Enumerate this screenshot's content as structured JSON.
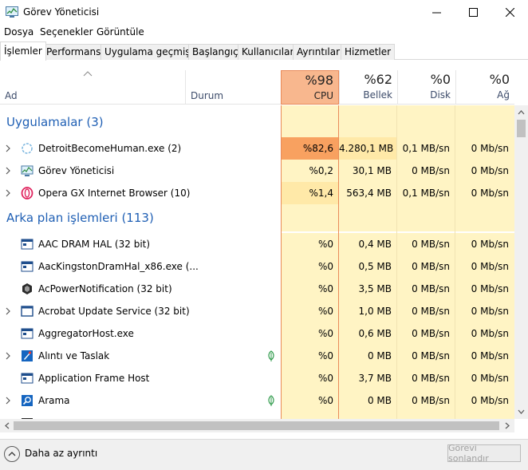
{
  "window": {
    "title": "Görev Yöneticisi"
  },
  "menu": [
    "Dosya",
    "Seçenekler",
    "Görüntüle"
  ],
  "tabs": [
    "İşlemler",
    "Performans",
    "Uygulama geçmişi",
    "Başlangıç",
    "Kullanıcılar",
    "Ayrıntılar",
    "Hizmetler"
  ],
  "header": {
    "name_label": "Ad",
    "status_label": "Durum",
    "cpu": {
      "pct": "%98",
      "label": "CPU"
    },
    "memory": {
      "pct": "%62",
      "label": "Bellek"
    },
    "disk": {
      "pct": "%0",
      "label": "Disk"
    },
    "network": {
      "pct": "%0",
      "label": "Ağ"
    }
  },
  "groups": {
    "apps": "Uygulamalar (3)",
    "background": "Arka plan işlemleri (113)"
  },
  "apps": [
    {
      "name": "DetroitBecomeHuman.exe (2)",
      "cpu": "%82,6",
      "mem": "4.280,1 MB",
      "disk": "0,1 MB/sn",
      "net": "0 Mb/sn",
      "icon": "loading-circle-icon"
    },
    {
      "name": "Görev Yöneticisi",
      "cpu": "%0,2",
      "mem": "30,1 MB",
      "disk": "0 MB/sn",
      "net": "0 Mb/sn",
      "icon": "task-manager-icon"
    },
    {
      "name": "Opera GX Internet Browser (10)",
      "cpu": "%1,4",
      "mem": "563,4 MB",
      "disk": "0,1 MB/sn",
      "net": "0 Mb/sn",
      "icon": "opera-icon"
    }
  ],
  "background": [
    {
      "name": "AAC DRAM HAL (32 bit)",
      "cpu": "%0",
      "mem": "0,4 MB",
      "disk": "0 MB/sn",
      "net": "0 Mb/sn",
      "icon": "window-app-icon"
    },
    {
      "name": "AacKingstonDramHal_x86.exe (...",
      "cpu": "%0",
      "mem": "0,5 MB",
      "disk": "0 MB/sn",
      "net": "0 Mb/sn",
      "icon": "window-app-icon"
    },
    {
      "name": "AcPowerNotification (32 bit)",
      "cpu": "%0",
      "mem": "3,5 MB",
      "disk": "0 MB/sn",
      "net": "0 Mb/sn",
      "icon": "hex-icon"
    },
    {
      "name": "Acrobat Update Service (32 bit)",
      "cpu": "%0",
      "mem": "1,0 MB",
      "disk": "0 MB/sn",
      "net": "0 Mb/sn",
      "icon": "window-app-icon"
    },
    {
      "name": "AggregatorHost.exe",
      "cpu": "%0",
      "mem": "0,6 MB",
      "disk": "0 MB/sn",
      "net": "0 Mb/sn",
      "icon": "window-app-icon"
    },
    {
      "name": "Alıntı ve Taslak",
      "cpu": "%0",
      "mem": "0 MB",
      "disk": "0 MB/sn",
      "net": "0 Mb/sn",
      "icon": "snip-icon"
    },
    {
      "name": "Application Frame Host",
      "cpu": "%0",
      "mem": "3,7 MB",
      "disk": "0 MB/sn",
      "net": "0 Mb/sn",
      "icon": "window-app-icon"
    },
    {
      "name": "Arama",
      "cpu": "%0",
      "mem": "0 MB",
      "disk": "0 MB/sn",
      "net": "0 Mb/sn",
      "icon": "search-app-icon"
    }
  ],
  "footer": {
    "fewer_details": "Daha az ayrıntı",
    "end_task": "Görevi sonlandır"
  },
  "colors": {
    "cpu_high": "#f8a160",
    "cpu_header": "#f8b78e",
    "cell_light": "#fff4c4",
    "cell_mid": "#ffe9a8",
    "group_blue": "#1f5fb4",
    "suspended_leaf": "#2e9a4a"
  }
}
